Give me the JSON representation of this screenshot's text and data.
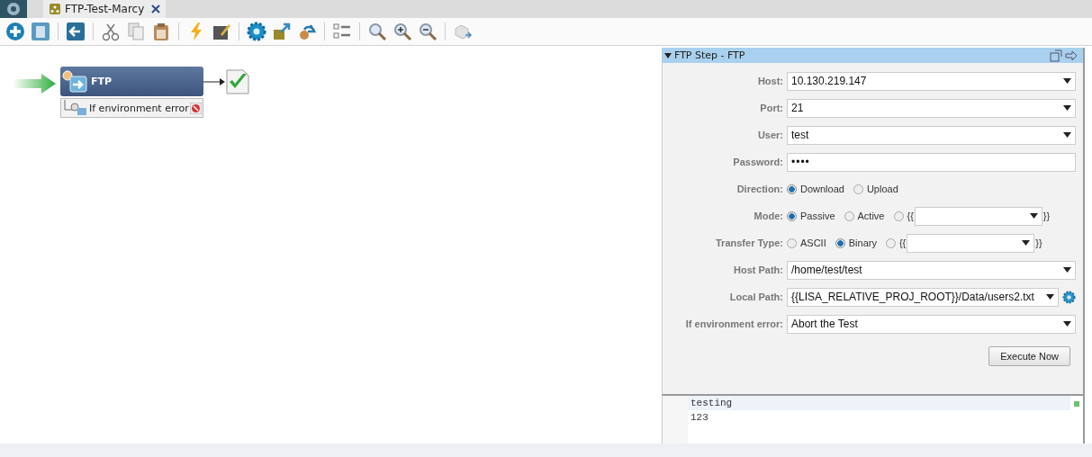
{
  "tabs": [
    {
      "label": "FTP-Test-Marcy",
      "selected": true
    }
  ],
  "canvas": {
    "node": {
      "title": "FTP",
      "handler": "If environment error"
    }
  },
  "panel": {
    "title": "FTP Step - FTP",
    "fields": [
      {
        "kind": "combo",
        "label": "Host:",
        "value": "10.130.219.147"
      },
      {
        "kind": "combo",
        "label": "Port:",
        "value": "21"
      },
      {
        "kind": "combo",
        "label": "User:",
        "value": "test"
      },
      {
        "kind": "password",
        "label": "Password:",
        "value": "••••"
      },
      {
        "kind": "radio",
        "label": "Direction:",
        "options": [
          {
            "label": "Download",
            "selected": true
          },
          {
            "label": "Upload",
            "selected": false
          }
        ]
      },
      {
        "kind": "radio",
        "label": "Mode:",
        "options": [
          {
            "label": "Passive",
            "selected": true
          },
          {
            "label": "Active",
            "selected": false
          }
        ],
        "expression": {
          "open": "{{",
          "close": "}}",
          "selected": false
        }
      },
      {
        "kind": "radio",
        "label": "Transfer Type:",
        "options": [
          {
            "label": "ASCII",
            "selected": false
          },
          {
            "label": "Binary",
            "selected": true
          }
        ],
        "expression": {
          "open": "{{",
          "close": "}}",
          "selected": false
        }
      },
      {
        "kind": "combo",
        "label": "Host Path:",
        "value": "/home/test/test"
      },
      {
        "kind": "path",
        "label": "Local Path:",
        "value": "{{LISA_RELATIVE_PROJ_ROOT}}/Data/users2.txt"
      },
      {
        "kind": "combo",
        "label": "If environment error:",
        "value": "Abort the Test"
      }
    ],
    "button": "Execute Now"
  },
  "editor": {
    "lines": [
      {
        "text": "testing",
        "current": true
      },
      {
        "text": "123",
        "current": false
      }
    ]
  }
}
